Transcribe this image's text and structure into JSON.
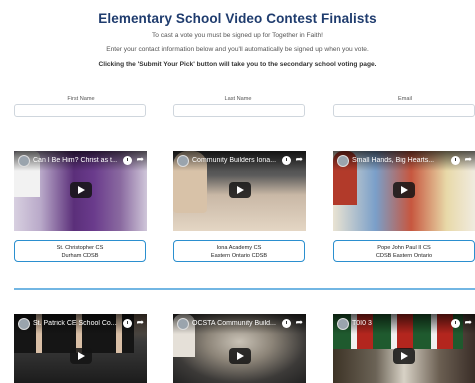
{
  "header": {
    "title": "Elementary School Video Contest Finalists",
    "line1": "To cast a vote you must be signed up for Together in Faith!",
    "line2": "Enter your contact information below and you'll automatically be signed up when you vote.",
    "line3": "Clicking the 'Submit Your Pick' button will take you to the secondary school voting page."
  },
  "form": {
    "first_name_label": "First Name",
    "last_name_label": "Last Name",
    "email_label": "Email"
  },
  "videos": [
    {
      "title": "Can I Be Him? Christ as t...",
      "school": "St. Christopher CS",
      "board": "Durham CDSB"
    },
    {
      "title": "Community Builders Iona...",
      "school": "Iona Academy CS",
      "board": "Eastern Ontario CDSB"
    },
    {
      "title": "Small Hands, Big Hearts...",
      "school": "Pope John Paul II CS",
      "board": "CDSB Eastern Ontario"
    },
    {
      "title": "St. Patrick CE School Co...",
      "school": "",
      "board": ""
    },
    {
      "title": "OCSTA Community Build...",
      "school": "",
      "board": ""
    },
    {
      "title": "T0I0 3",
      "school": "",
      "board": ""
    }
  ],
  "colors": {
    "title": "#1f3c6e",
    "accent": "#2b8fcf",
    "divider": "#72b6e3"
  },
  "icons": {
    "clock": "watch-later-icon",
    "share": "share-icon",
    "play": "play-icon"
  }
}
